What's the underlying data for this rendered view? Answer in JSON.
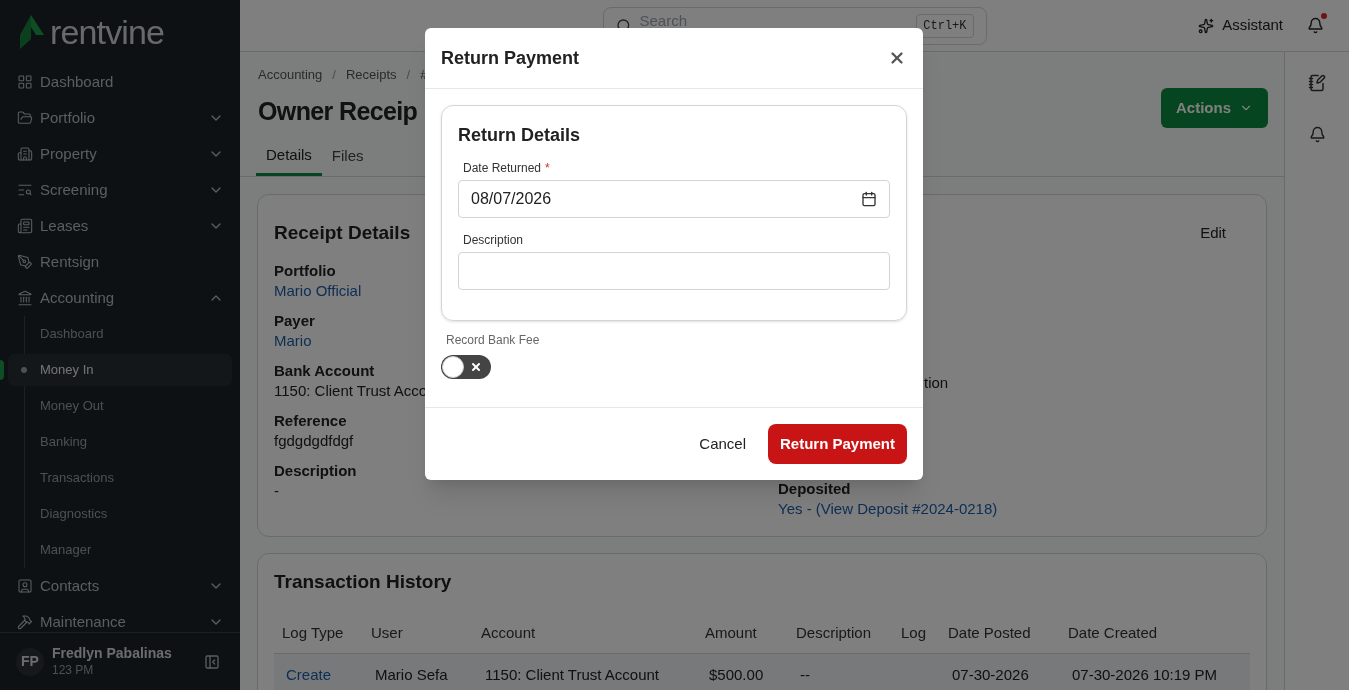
{
  "sidebar": {
    "logo": "rentvine",
    "items": [
      {
        "label": "Dashboard",
        "expandable": false
      },
      {
        "label": "Portfolio",
        "expandable": true,
        "expanded": false
      },
      {
        "label": "Property",
        "expandable": true,
        "expanded": false
      },
      {
        "label": "Screening",
        "expandable": true,
        "expanded": false
      },
      {
        "label": "Leases",
        "expandable": true,
        "expanded": false
      },
      {
        "label": "Rentsign",
        "expandable": false
      },
      {
        "label": "Accounting",
        "expandable": true,
        "expanded": true,
        "children": [
          {
            "label": "Dashboard",
            "selected": false
          },
          {
            "label": "Money In",
            "selected": true
          },
          {
            "label": "Money Out",
            "selected": false
          },
          {
            "label": "Banking",
            "selected": false
          },
          {
            "label": "Transactions",
            "selected": false
          },
          {
            "label": "Diagnostics",
            "selected": false
          },
          {
            "label": "Manager",
            "selected": false
          }
        ]
      },
      {
        "label": "Contacts",
        "expandable": true,
        "expanded": false
      },
      {
        "label": "Maintenance",
        "expandable": true,
        "expanded": false
      }
    ],
    "user": {
      "initials": "FP",
      "name": "Fredlyn Pabalinas",
      "subtitle": "123 PM"
    }
  },
  "topbar": {
    "search_placeholder": "Search",
    "shortcut": "Ctrl+K",
    "assistant": "Assistant",
    "notification_unread": true
  },
  "page": {
    "breadcrumbs": [
      {
        "kind": "link",
        "label": "Accounting"
      },
      {
        "kind": "separator",
        "label": "/"
      },
      {
        "kind": "link",
        "label": "Receipts"
      },
      {
        "kind": "separator",
        "label": "/"
      },
      {
        "kind": "link",
        "label": "#"
      }
    ],
    "title": "Owner Receip",
    "actions": "Actions",
    "tabs": [
      {
        "label": "Details",
        "selected": true
      },
      {
        "label": "Files",
        "selected": false
      }
    ],
    "receipt_details": {
      "title": "Receipt Details",
      "edit": "Edit",
      "fields": [
        {
          "label": "Portfolio",
          "value": "Mario Official",
          "link": true
        },
        {
          "label": "Payer",
          "value": "Mario",
          "link": true
        },
        {
          "label": "Bank Account",
          "value": "1150: Client Trust Acco",
          "link": false
        },
        {
          "label": "Reference",
          "value": "fgdgdgdfdgf",
          "link": false
        },
        {
          "label": "Description",
          "value": "-",
          "link": false
        }
      ],
      "right_fragment": "tion",
      "right_fields": [
        {
          "label": "Deposited",
          "value": "Yes - (View Deposit #2024-0218)",
          "link": true
        }
      ]
    },
    "transaction_history": {
      "title": "Transaction History",
      "columns": [
        "Log Type",
        "User",
        "Account",
        "Amount",
        "Description",
        "Log",
        "Date Posted",
        "Date Created"
      ],
      "rows": [
        [
          "Create",
          "Mario Sefa",
          "1150: Client Trust Account",
          "$500.00",
          "--",
          "",
          "07-30-2026",
          "07-30-2026 10:19 PM"
        ]
      ]
    }
  },
  "modal": {
    "title": "Return Payment",
    "section_title": "Return Details",
    "date_field": {
      "label": "Date Returned",
      "required_mark": "*",
      "value": "08/07/2026"
    },
    "description_field": {
      "label": "Description"
    },
    "bank_fee": {
      "label": "Record Bank Fee",
      "on": false
    },
    "cancel": "Cancel",
    "submit": "Return Payment"
  }
}
